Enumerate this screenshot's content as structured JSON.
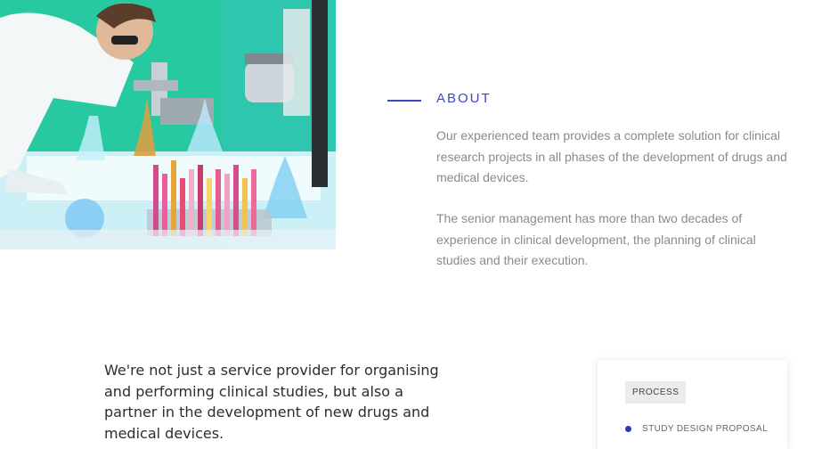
{
  "about": {
    "title": "ABOUT",
    "paragraphs": [
      "Our experienced team provides a complete solution for clinical research projects in all phases of the development of drugs and medical devices.",
      "The senior management has more than two decades of experience in clinical development, the planning of clinical studies and their execution."
    ]
  },
  "statement": {
    "text": "We're not just a service provider for organising and performing clinical studies, but also a partner in the development of new drugs and medical devices."
  },
  "process": {
    "badge": "PROCESS",
    "steps": [
      {
        "label": "STUDY DESIGN PROPOSAL"
      }
    ]
  },
  "colors": {
    "accent": "#3d47c5",
    "step_dot": "#2a3db8",
    "body_text": "#8a8a8a"
  }
}
